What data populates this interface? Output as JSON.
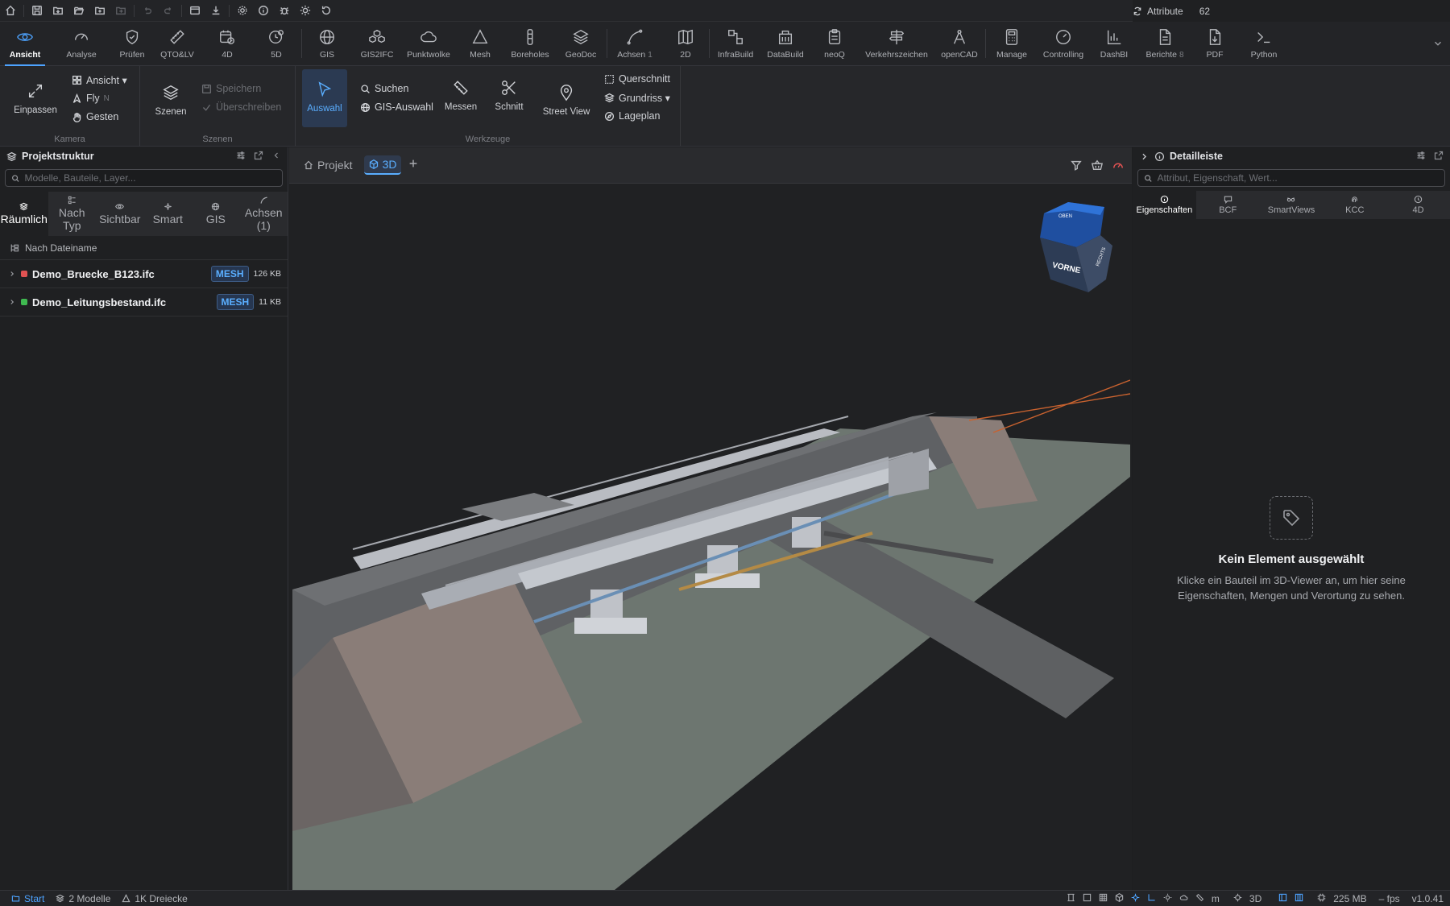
{
  "quickbar": {
    "attribute_label": "Attribute",
    "attribute_count": "62"
  },
  "tabs": [
    {
      "label": "Ansicht",
      "icon": "eye-icon"
    },
    {
      "label": "Analyse",
      "icon": "gauge-icon"
    },
    {
      "label": "Prüfen",
      "icon": "shield-check-icon"
    },
    {
      "label": "QTO&LV",
      "icon": "ruler-icon"
    },
    {
      "label": "4D",
      "icon": "calendar-clock-icon"
    },
    {
      "label": "5D",
      "icon": "dollar-clock-icon"
    },
    {
      "label": "GIS",
      "icon": "globe-icon"
    },
    {
      "label": "GIS2IFC",
      "icon": "cubes-icon"
    },
    {
      "label": "Punktwolke",
      "icon": "cloud-icon"
    },
    {
      "label": "Mesh",
      "icon": "triangle-icon"
    },
    {
      "label": "Boreholes",
      "icon": "borehole-icon"
    },
    {
      "label": "GeoDoc",
      "icon": "layers-icon"
    },
    {
      "label": "Achsen",
      "count": "1",
      "icon": "curve-icon"
    },
    {
      "label": "2D",
      "icon": "map-icon"
    },
    {
      "label": "InfraBuild",
      "icon": "blocks-icon"
    },
    {
      "label": "DataBuild",
      "icon": "building-icon"
    },
    {
      "label": "neoQ",
      "icon": "clipboard-icon"
    },
    {
      "label": "Verkehrszeichen",
      "icon": "signpost-icon"
    },
    {
      "label": "openCAD",
      "icon": "compass-icon"
    },
    {
      "label": "Manage",
      "icon": "calculator-icon"
    },
    {
      "label": "Controlling",
      "icon": "gauge-circle-icon"
    },
    {
      "label": "DashBI",
      "icon": "bar-chart-icon"
    },
    {
      "label": "Berichte",
      "count": "8",
      "icon": "file-text-icon"
    },
    {
      "label": "PDF",
      "icon": "file-export-icon"
    },
    {
      "label": "Python",
      "icon": "terminal-icon"
    }
  ],
  "ribbon": {
    "kamera": {
      "title": "Kamera",
      "fit": "Einpassen",
      "view": "Ansicht ▾",
      "fly": "Fly",
      "fly_key": "N",
      "gestures": "Gesten"
    },
    "szenen": {
      "title": "Szenen",
      "scenes": "Szenen",
      "save": "Speichern",
      "overwrite": "Überschreiben"
    },
    "werkzeuge": {
      "title": "Werkzeuge",
      "select": "Auswahl",
      "search": "Suchen",
      "gis_select": "GIS-Auswahl",
      "measure": "Messen",
      "cut": "Schnitt",
      "street_view": "Street View",
      "cross_section": "Querschnitt",
      "floorplan": "Grundriss ▾",
      "site_plan": "Lageplan"
    }
  },
  "left_panel": {
    "title": "Projektstruktur",
    "search_placeholder": "Modelle, Bauteile, Layer...",
    "tabs": [
      {
        "label": "Räumlich"
      },
      {
        "label": "Nach Typ"
      },
      {
        "label": "Sichtbar"
      },
      {
        "label": "Smart"
      },
      {
        "label": "GIS"
      },
      {
        "label": "Achsen (1)"
      }
    ],
    "group_by": "Nach Dateiname",
    "files": [
      {
        "name": "Demo_Bruecke_B123.ifc",
        "badge": "MESH",
        "size": "126 KB",
        "color": "#e05252"
      },
      {
        "name": "Demo_Leitungsbestand.ifc",
        "badge": "MESH",
        "size": "11 KB",
        "color": "#3fb950"
      }
    ]
  },
  "viewer": {
    "tab_project": "Projekt",
    "tab_3d": "3D",
    "navcube_front": "VORNE",
    "navcube_right": "RECHTS",
    "navcube_top": "OBEN"
  },
  "right_panel": {
    "title": "Detailleiste",
    "search_placeholder": "Attribut, Eigenschaft, Wert...",
    "tabs": [
      {
        "label": "Eigenschaften"
      },
      {
        "label": "BCF"
      },
      {
        "label": "SmartViews"
      },
      {
        "label": "KCC"
      },
      {
        "label": "4D"
      }
    ],
    "empty_title": "Kein Element ausgewählt",
    "empty_text": "Klicke ein Bauteil im 3D-Viewer an, um hier seine Eigenschaften, Mengen und Verortung zu sehen."
  },
  "status": {
    "start": "Start",
    "models": "2 Modelle",
    "triangles": "1K Dreiecke",
    "unit": "m",
    "mode": "3D",
    "memory": "225 MB",
    "fps": "– fps",
    "version": "v1.0.41"
  }
}
